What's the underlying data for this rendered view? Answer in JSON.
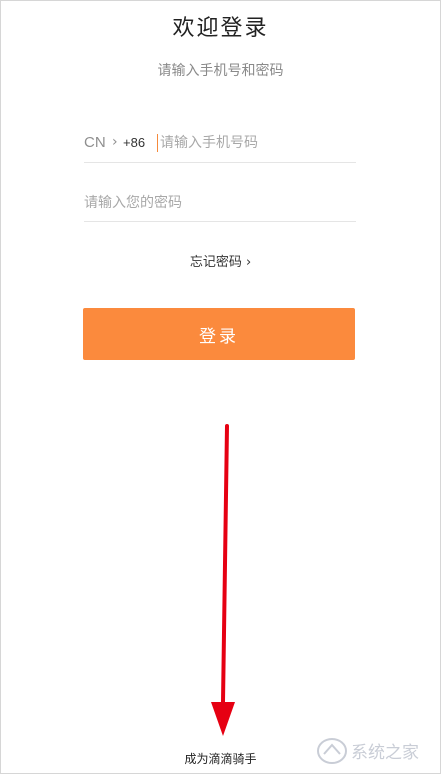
{
  "header": {
    "title": "欢迎登录",
    "subtitle": "请输入手机号和密码"
  },
  "phone": {
    "country": "CN",
    "country_chevron": "›",
    "prefix": "+86",
    "placeholder": "请输入手机号码",
    "value": ""
  },
  "password": {
    "placeholder": "请输入您的密码",
    "value": ""
  },
  "forgot": {
    "label": "忘记密码 ›"
  },
  "login": {
    "label": "登录"
  },
  "footer": {
    "become_rider": "成为滴滴骑手"
  },
  "annotation": {
    "arrow_icon": "down-arrow-icon",
    "arrow_color": "#e60012"
  },
  "watermark": {
    "text": "系统之家"
  },
  "colors": {
    "accent": "#fb8a3d",
    "cursor": "#f58a3c"
  }
}
